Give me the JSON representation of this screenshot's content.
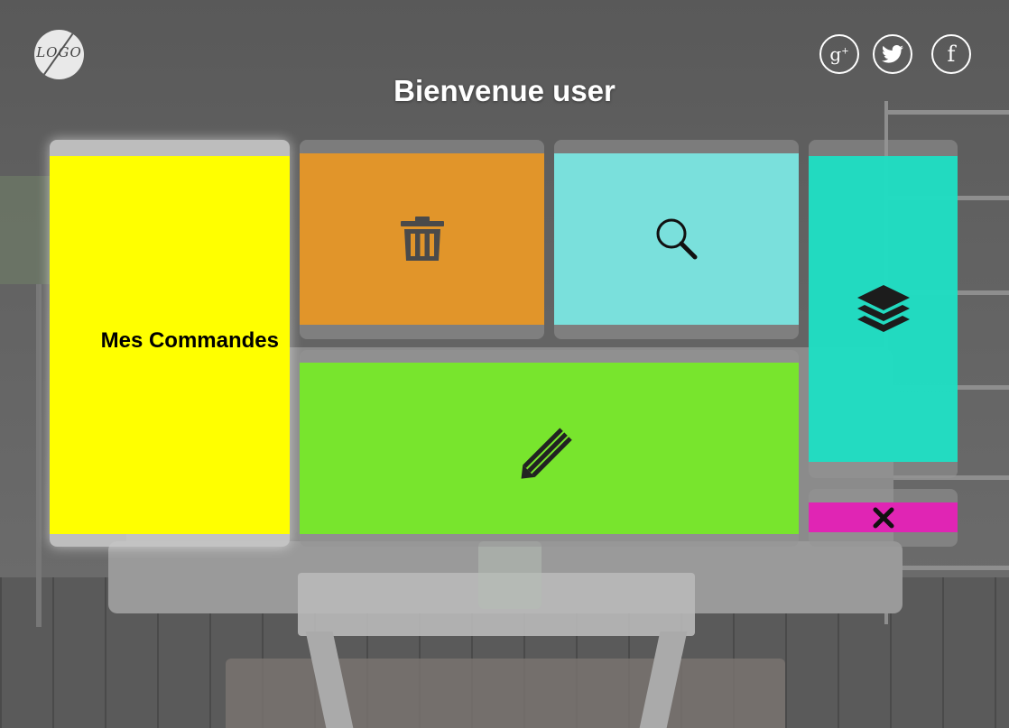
{
  "header": {
    "logo_text": "LOGO",
    "title": "Bienvenue user"
  },
  "social": [
    {
      "name": "google-plus",
      "glyph": "g+"
    },
    {
      "name": "twitter",
      "glyph": "twitter-bird"
    },
    {
      "name": "facebook",
      "glyph": "f"
    }
  ],
  "tiles": {
    "commandes": {
      "label": "Mes Commandes",
      "color": "#ffff00"
    },
    "delete": {
      "icon": "trash-icon",
      "color": "#e1952a"
    },
    "search": {
      "icon": "search-icon",
      "color": "#7ae0dc"
    },
    "edit": {
      "icon": "pencil-icon",
      "color": "#76ec26"
    },
    "layers": {
      "icon": "layers-icon",
      "color": "#1edfc4"
    },
    "close": {
      "icon": "close-icon",
      "color": "#e025b4"
    }
  }
}
